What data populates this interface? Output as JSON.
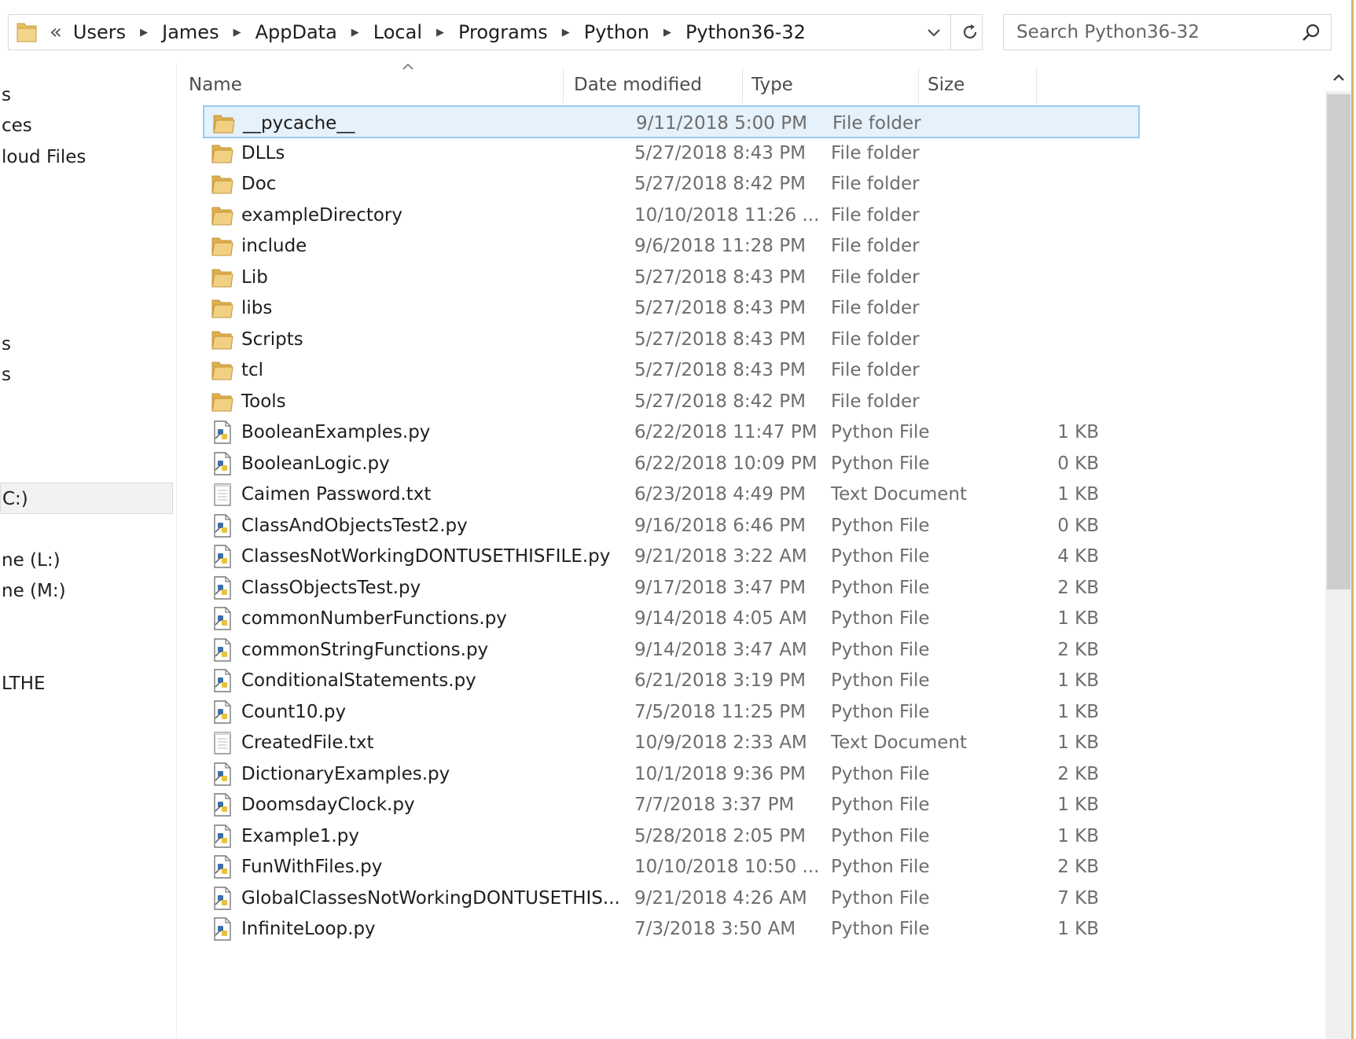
{
  "address_bar": {
    "overflow_chevron": "«",
    "breadcrumbs": [
      "Users",
      "James",
      "AppData",
      "Local",
      "Programs",
      "Python",
      "Python36-32"
    ]
  },
  "search": {
    "placeholder": "Search Python36-32"
  },
  "nav_items": [
    {
      "label": "s",
      "selected": false
    },
    {
      "label": "ces",
      "selected": false
    },
    {
      "label": "loud Files",
      "selected": false
    },
    {
      "label": "s",
      "selected": false
    },
    {
      "label": "s",
      "selected": false
    },
    {
      "label": "C:)",
      "selected": true
    },
    {
      "label": "ne (L:)",
      "selected": false
    },
    {
      "label": "ne (M:)",
      "selected": false
    },
    {
      "label": "LTHE",
      "selected": false
    }
  ],
  "columns": {
    "name": "Name",
    "date": "Date modified",
    "type": "Type",
    "size": "Size"
  },
  "files": [
    {
      "name": "__pycache__",
      "date": "9/11/2018 5:00 PM",
      "type": "File folder",
      "size": "",
      "kind": "folder",
      "selected": true
    },
    {
      "name": "DLLs",
      "date": "5/27/2018 8:43 PM",
      "type": "File folder",
      "size": "",
      "kind": "folder"
    },
    {
      "name": "Doc",
      "date": "5/27/2018 8:42 PM",
      "type": "File folder",
      "size": "",
      "kind": "folder"
    },
    {
      "name": "exampleDirectory",
      "date": "10/10/2018 11:26 ...",
      "type": "File folder",
      "size": "",
      "kind": "folder"
    },
    {
      "name": "include",
      "date": "9/6/2018 11:28 PM",
      "type": "File folder",
      "size": "",
      "kind": "folder"
    },
    {
      "name": "Lib",
      "date": "5/27/2018 8:43 PM",
      "type": "File folder",
      "size": "",
      "kind": "folder"
    },
    {
      "name": "libs",
      "date": "5/27/2018 8:43 PM",
      "type": "File folder",
      "size": "",
      "kind": "folder"
    },
    {
      "name": "Scripts",
      "date": "5/27/2018 8:43 PM",
      "type": "File folder",
      "size": "",
      "kind": "folder"
    },
    {
      "name": "tcl",
      "date": "5/27/2018 8:43 PM",
      "type": "File folder",
      "size": "",
      "kind": "folder"
    },
    {
      "name": "Tools",
      "date": "5/27/2018 8:42 PM",
      "type": "File folder",
      "size": "",
      "kind": "folder"
    },
    {
      "name": "BooleanExamples.py",
      "date": "6/22/2018 11:47 PM",
      "type": "Python File",
      "size": "1 KB",
      "kind": "python"
    },
    {
      "name": "BooleanLogic.py",
      "date": "6/22/2018 10:09 PM",
      "type": "Python File",
      "size": "0 KB",
      "kind": "python"
    },
    {
      "name": "Caimen Password.txt",
      "date": "6/23/2018 4:49 PM",
      "type": "Text Document",
      "size": "1 KB",
      "kind": "text"
    },
    {
      "name": "ClassAndObjectsTest2.py",
      "date": "9/16/2018 6:46 PM",
      "type": "Python File",
      "size": "0 KB",
      "kind": "python"
    },
    {
      "name": "ClassesNotWorkingDONTUSETHISFILE.py",
      "date": "9/21/2018 3:22 AM",
      "type": "Python File",
      "size": "4 KB",
      "kind": "python"
    },
    {
      "name": "ClassObjectsTest.py",
      "date": "9/17/2018 3:47 PM",
      "type": "Python File",
      "size": "2 KB",
      "kind": "python"
    },
    {
      "name": "commonNumberFunctions.py",
      "date": "9/14/2018 4:05 AM",
      "type": "Python File",
      "size": "1 KB",
      "kind": "python"
    },
    {
      "name": "commonStringFunctions.py",
      "date": "9/14/2018 3:47 AM",
      "type": "Python File",
      "size": "2 KB",
      "kind": "python"
    },
    {
      "name": "ConditionalStatements.py",
      "date": "6/21/2018 3:19 PM",
      "type": "Python File",
      "size": "1 KB",
      "kind": "python"
    },
    {
      "name": "Count10.py",
      "date": "7/5/2018 11:25 PM",
      "type": "Python File",
      "size": "1 KB",
      "kind": "python"
    },
    {
      "name": "CreatedFile.txt",
      "date": "10/9/2018 2:33 AM",
      "type": "Text Document",
      "size": "1 KB",
      "kind": "text"
    },
    {
      "name": "DictionaryExamples.py",
      "date": "10/1/2018 9:36 PM",
      "type": "Python File",
      "size": "2 KB",
      "kind": "python"
    },
    {
      "name": "DoomsdayClock.py",
      "date": "7/7/2018 3:37 PM",
      "type": "Python File",
      "size": "1 KB",
      "kind": "python"
    },
    {
      "name": "Example1.py",
      "date": "5/28/2018 2:05 PM",
      "type": "Python File",
      "size": "1 KB",
      "kind": "python"
    },
    {
      "name": "FunWithFiles.py",
      "date": "10/10/2018 10:50 ...",
      "type": "Python File",
      "size": "2 KB",
      "kind": "python"
    },
    {
      "name": "GlobalClassesNotWorkingDONTUSETHIS...",
      "date": "9/21/2018 4:26 AM",
      "type": "Python File",
      "size": "7 KB",
      "kind": "python"
    },
    {
      "name": "InfiniteLoop.py",
      "date": "7/3/2018 3:50 AM",
      "type": "Python File",
      "size": "1 KB",
      "kind": "python"
    }
  ],
  "colors": {
    "selection_bg": "#e5f1fb",
    "selection_border": "#99c9ef",
    "folder": "#e8c064",
    "accent_frame": "#dcb36a"
  }
}
